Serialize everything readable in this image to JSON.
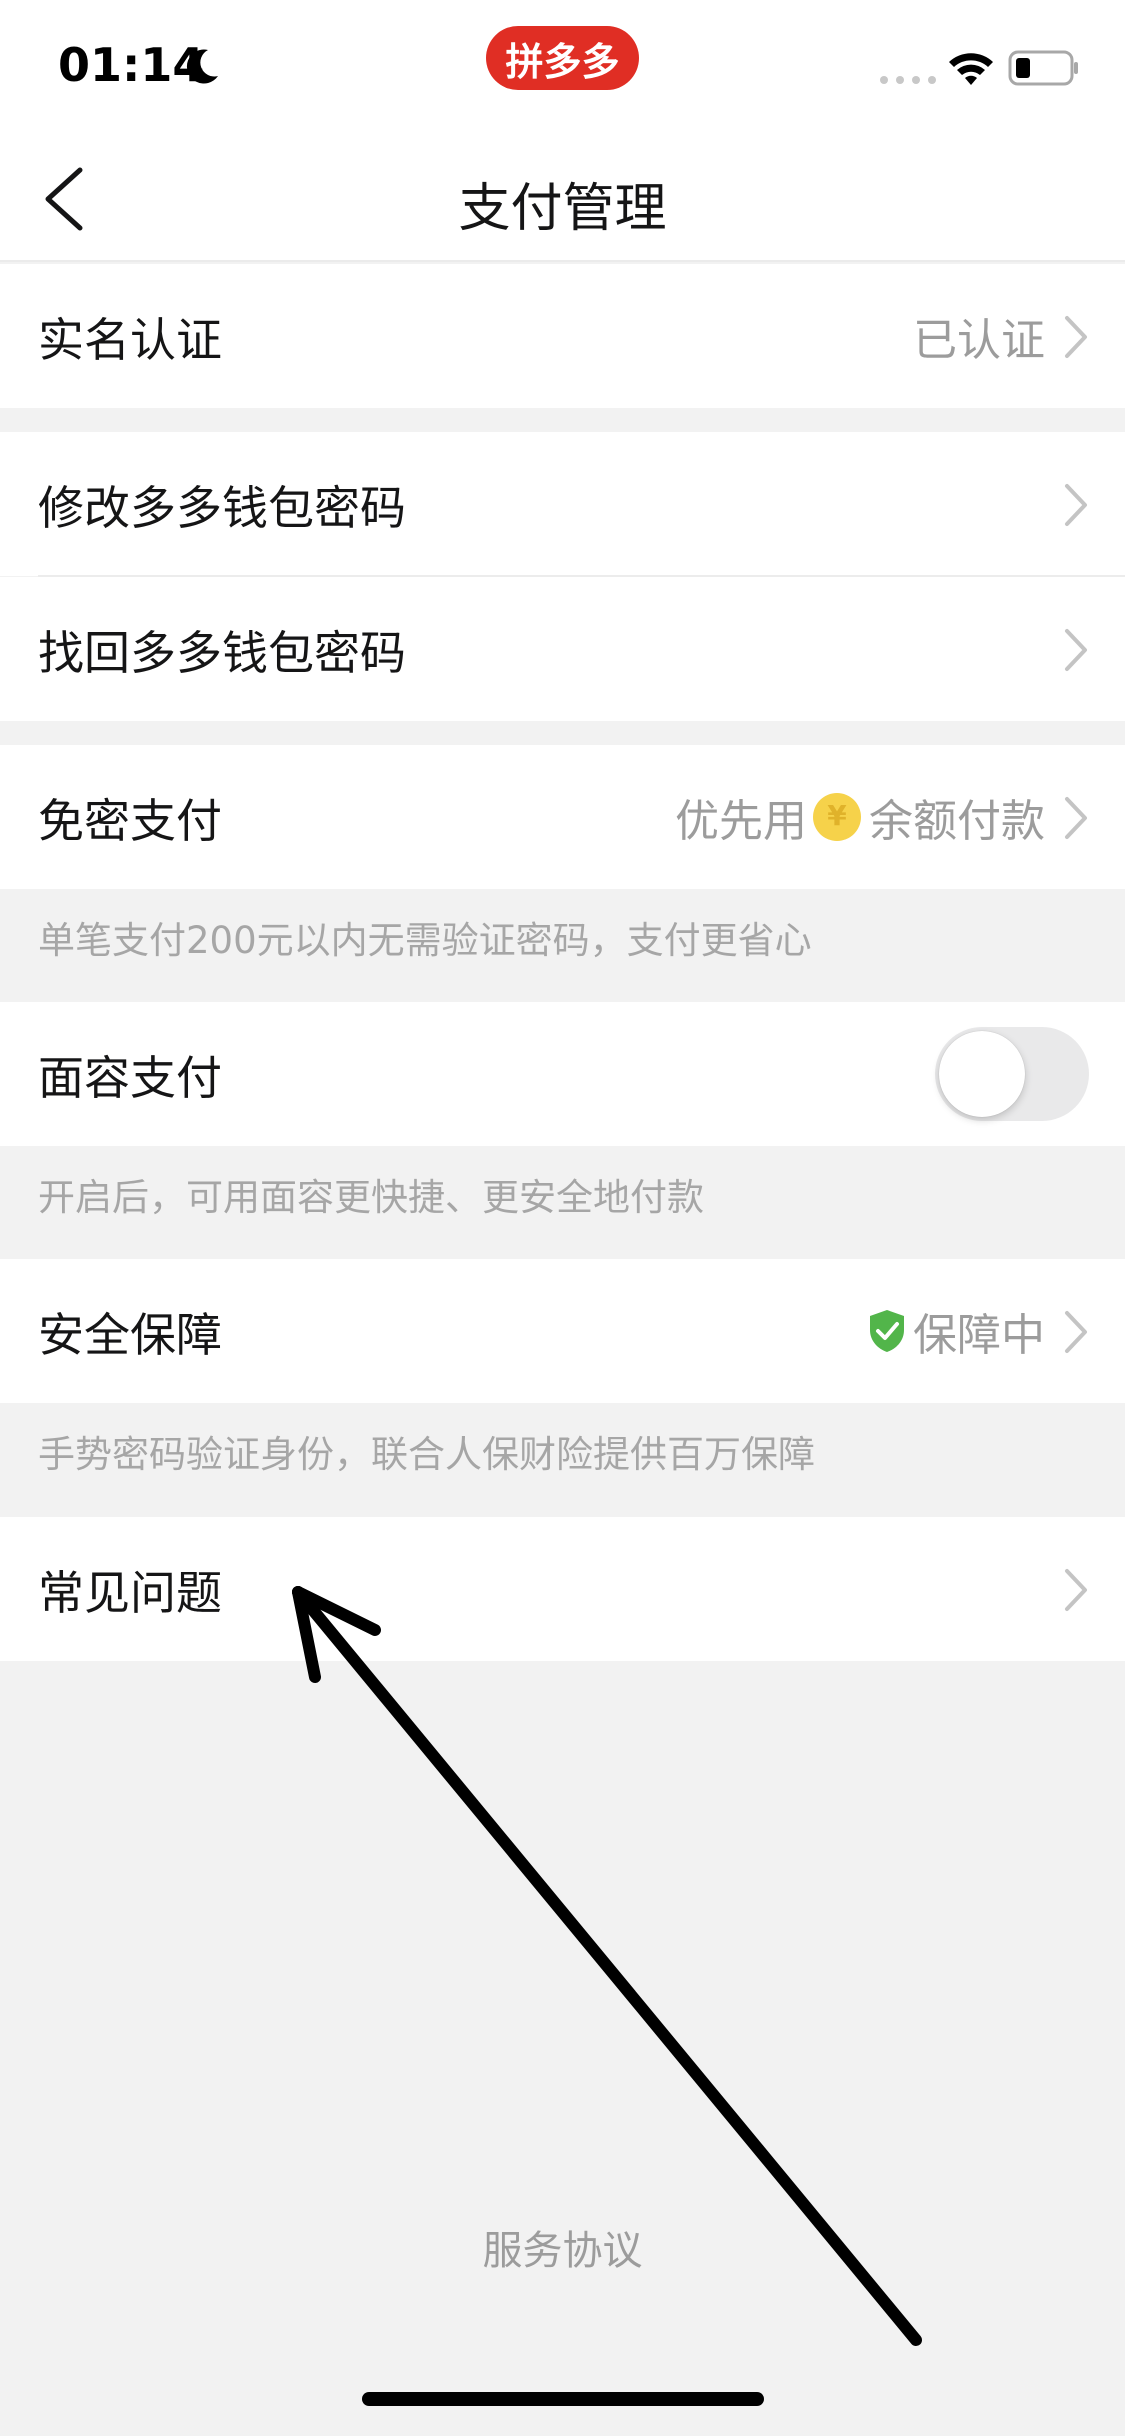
{
  "status_bar": {
    "time": "01:14",
    "app_badge": "拼多多"
  },
  "nav": {
    "title": "支付管理"
  },
  "rows": {
    "real_name": {
      "label": "实名认证",
      "value": "已认证"
    },
    "change_password": {
      "label": "修改多多钱包密码"
    },
    "recover_password": {
      "label": "找回多多钱包密码"
    },
    "password_free": {
      "label": "免密支付",
      "value_prefix": "优先用",
      "coin_symbol": "¥",
      "value_suffix": "余额付款",
      "hint": "单笔支付200元以内无需验证密码，支付更省心"
    },
    "face_pay": {
      "label": "面容支付",
      "enabled": false,
      "hint": "开启后，可用面容更快捷、更安全地付款"
    },
    "security": {
      "label": "安全保障",
      "value": "保障中",
      "hint": "手势密码验证身份，联合人保财险提供百万保障"
    },
    "faq": {
      "label": "常见问题"
    }
  },
  "footer": {
    "service_agreement": "服务协议"
  },
  "colors": {
    "brand_red": "#e02e24",
    "shield_green": "#52b54a",
    "coin_yellow": "#f6d24a"
  },
  "icons": [
    "moon-icon",
    "wifi-icon",
    "battery-icon",
    "back-arrow-icon",
    "chevron-right-icon",
    "coin-icon",
    "shield-check-icon",
    "annotation-arrow"
  ]
}
